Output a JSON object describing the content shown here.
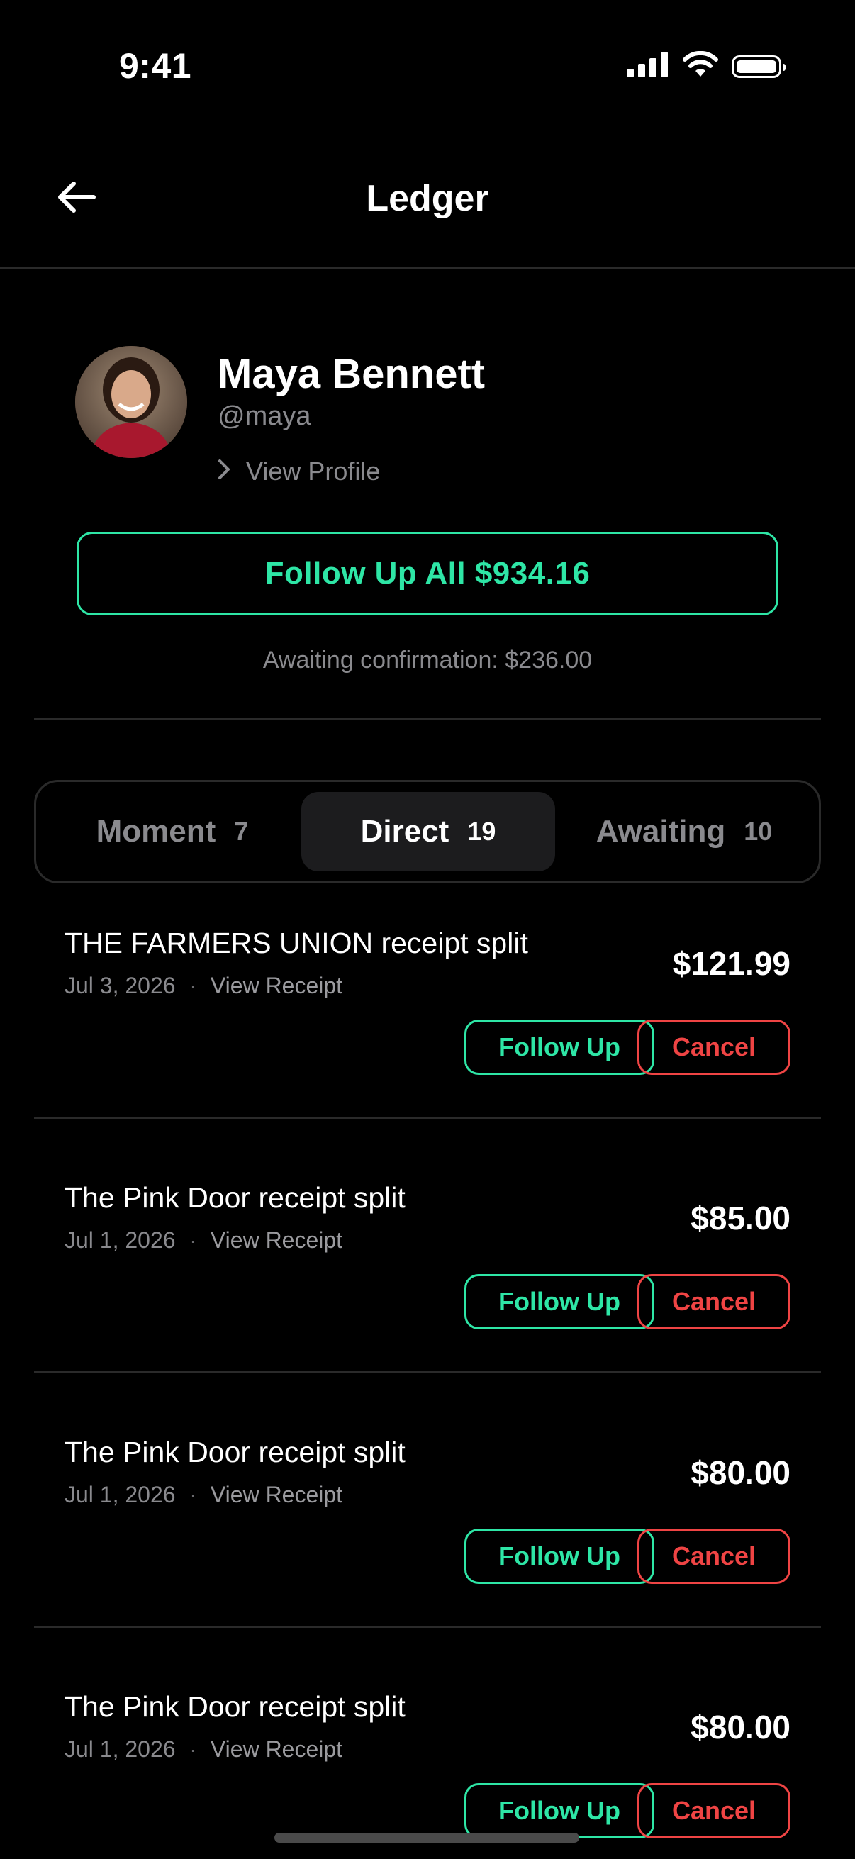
{
  "status_bar": {
    "time": "9:41"
  },
  "nav": {
    "title": "Ledger"
  },
  "profile": {
    "name": "Maya Bennett",
    "handle": "@maya",
    "view_profile_label": "View Profile"
  },
  "follow_up_all_label": "Follow Up All $934.16",
  "awaiting_confirmation": "Awaiting confirmation: $236.00",
  "tabs": [
    {
      "label": "Moment",
      "count": "7",
      "active": false
    },
    {
      "label": "Direct",
      "count": "19",
      "active": true
    },
    {
      "label": "Awaiting",
      "count": "10",
      "active": false
    }
  ],
  "rows": [
    {
      "title": "THE FARMERS UNION receipt split",
      "date": "Jul 3, 2026",
      "separator": "·",
      "link": "View Receipt",
      "amount": "$121.99",
      "follow_label": "Follow Up",
      "cancel_label": "Cancel"
    },
    {
      "title": "The Pink Door receipt split",
      "date": "Jul 1, 2026",
      "separator": "·",
      "link": "View Receipt",
      "amount": "$85.00",
      "follow_label": "Follow Up",
      "cancel_label": "Cancel"
    },
    {
      "title": "The Pink Door receipt split",
      "date": "Jul 1, 2026",
      "separator": "·",
      "link": "View Receipt",
      "amount": "$80.00",
      "follow_label": "Follow Up",
      "cancel_label": "Cancel"
    },
    {
      "title": "The Pink Door receipt split",
      "date": "Jul 1, 2026",
      "separator": "·",
      "link": "View Receipt",
      "amount": "$80.00",
      "follow_label": "Follow Up",
      "cancel_label": "Cancel"
    }
  ],
  "colors": {
    "background": "#000000",
    "accent_green": "#2ee6a6",
    "cancel_red": "#ef4444",
    "muted_text": "#8a8a8e",
    "divider": "#2a2a2a"
  },
  "icons": [
    "signal-icon",
    "wifi-icon",
    "battery-icon",
    "back-arrow-icon",
    "chevron-right-icon"
  ]
}
